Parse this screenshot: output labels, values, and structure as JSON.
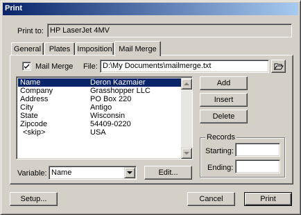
{
  "window": {
    "title": "Print"
  },
  "printer": {
    "label": "Print to:",
    "value": "HP LaserJet 4MV"
  },
  "tabs": [
    {
      "label": "General"
    },
    {
      "label": "Plates"
    },
    {
      "label": "Imposition"
    },
    {
      "label": "Mail Merge"
    }
  ],
  "active_tab": "Mail Merge",
  "mail_merge": {
    "checkbox_label": "Mail Merge",
    "checked": true,
    "file_label": "File:",
    "file_value": "D:\\My Documents\\mailmerge.txt",
    "records": [
      {
        "field": "Name",
        "value": "Deron Kazmaier"
      },
      {
        "field": "Company",
        "value": "Grasshopper LLC"
      },
      {
        "field": "Address",
        "value": "PO Box 220"
      },
      {
        "field": "City",
        "value": "Antigo"
      },
      {
        "field": "State",
        "value": "Wisconsin"
      },
      {
        "field": "Zipcode",
        "value": "54409-0220"
      },
      {
        "field": "<skip>",
        "value": "USA"
      }
    ],
    "selected_record": "Name",
    "add_label": "Add",
    "insert_label": "Insert",
    "delete_label": "Delete",
    "records_group_label": "Records",
    "starting_label": "Starting:",
    "starting_value": "",
    "ending_label": "Ending:",
    "ending_value": "",
    "variable_label": "Variable:",
    "variable_value": "Name",
    "edit_label": "Edit..."
  },
  "footer": {
    "setup_label": "Setup...",
    "cancel_label": "Cancel",
    "print_label": "Print"
  },
  "colors": {
    "titlebar_start": "#0a246a",
    "titlebar_end": "#a6caf0",
    "selection": "#0a246a",
    "face": "#d4d0c8"
  }
}
